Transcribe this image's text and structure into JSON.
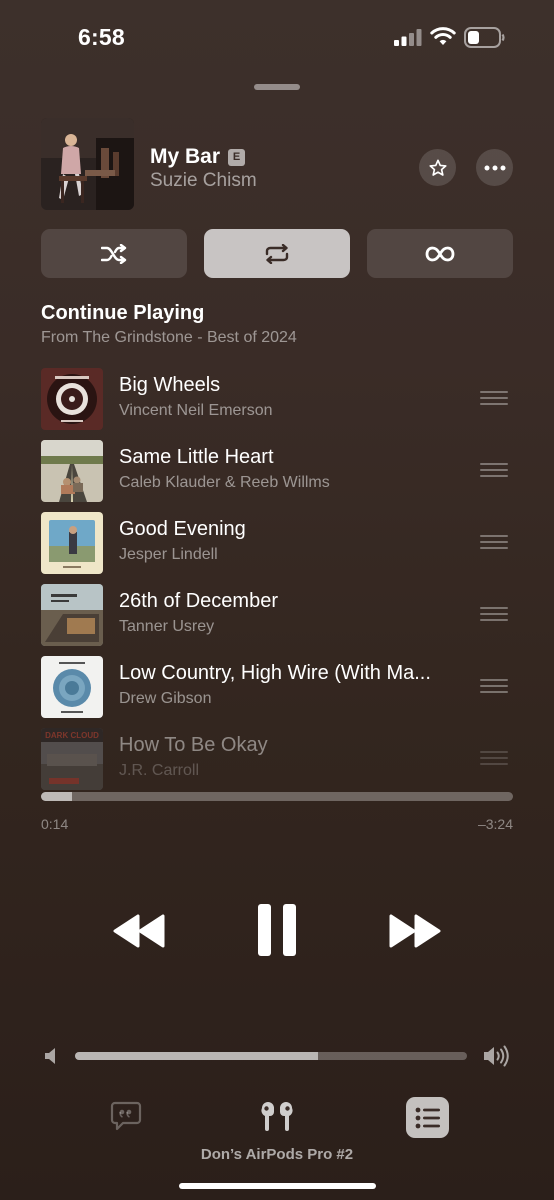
{
  "status_bar": {
    "time": "6:58",
    "icons": [
      "cellular-signal-icon",
      "wifi-icon",
      "battery-icon"
    ]
  },
  "now_playing": {
    "title": "My Bar",
    "explicit_badge": "E",
    "artist": "Suzie Chism",
    "favorite_icon": "star-icon",
    "more_icon": "ellipsis-icon"
  },
  "modes": [
    {
      "name": "shuffle",
      "icon": "shuffle-icon",
      "active": false
    },
    {
      "name": "repeat",
      "icon": "repeat-icon",
      "active": true
    },
    {
      "name": "autoplay",
      "icon": "infinity-icon",
      "active": false
    }
  ],
  "queue": {
    "heading": "Continue Playing",
    "subheading": "From The Grindstone - Best of 2024",
    "items": [
      {
        "title": "Big Wheels",
        "artist": "Vincent Neil Emerson"
      },
      {
        "title": "Same Little Heart",
        "artist": "Caleb Klauder & Reeb Willms"
      },
      {
        "title": "Good Evening",
        "artist": "Jesper Lindell"
      },
      {
        "title": "26th of December",
        "artist": "Tanner Usrey"
      },
      {
        "title": "Low Country, High Wire (With Ma...",
        "artist": "Drew Gibson"
      },
      {
        "title": "How To Be Okay",
        "artist": "J.R. Carroll",
        "album_text": "DARK CLOUD"
      }
    ]
  },
  "playback": {
    "elapsed": "0:14",
    "remaining": "–3:24",
    "progress": 0.066
  },
  "volume": {
    "level": 0.62
  },
  "bottom": {
    "device": "Don’s AirPods Pro #2"
  },
  "colors": {
    "background_top": "#3d302b",
    "background_bottom": "#2b1f1a",
    "accent_fill": "#ffffff"
  }
}
